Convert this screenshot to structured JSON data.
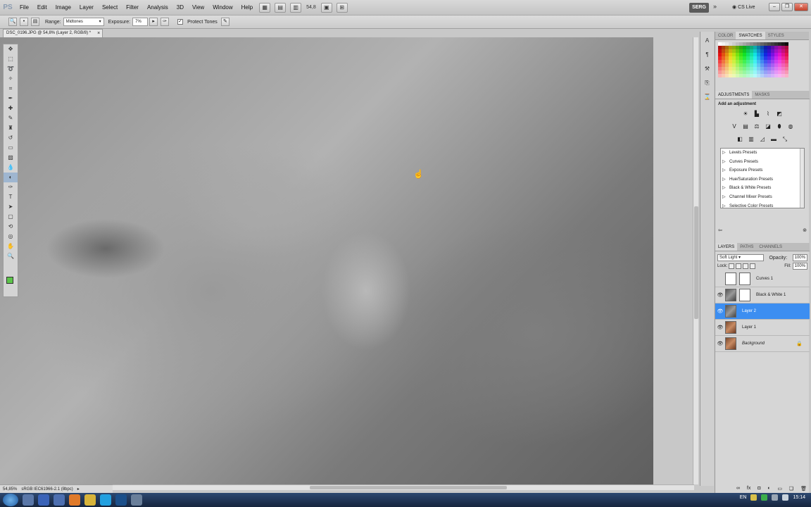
{
  "menubar": {
    "logo": "PS",
    "items": [
      "File",
      "Edit",
      "Image",
      "Layer",
      "Select",
      "Filter",
      "Analysis",
      "3D",
      "View",
      "Window",
      "Help"
    ],
    "zoom": "54,8",
    "workspace": "SERG",
    "cs_live": "CS Live"
  },
  "options": {
    "range_label": "Range:",
    "range_value": "Midtones",
    "exposure_label": "Exposure:",
    "exposure_value": "7%",
    "protect_tones_label": "Protect Tones"
  },
  "document": {
    "tab_title": "DSC_0196.JPG @ 54,8% (Layer 2, RGB/8) *"
  },
  "status": {
    "zoom": "54,85%",
    "profile": "sRGB IEC61966-2.1 (8bpc)"
  },
  "panels": {
    "top_tabs": [
      "COLOR",
      "SWATCHES",
      "STYLES"
    ],
    "adjust_tabs": [
      "ADJUSTMENTS",
      "MASKS"
    ],
    "adjust_title": "Add an adjustment",
    "presets": [
      "Levels Presets",
      "Curves Presets",
      "Exposure Presets",
      "Hue/Saturation Presets",
      "Black & White Presets",
      "Channel Mixer Presets",
      "Selective Color Presets"
    ],
    "layer_tabs": [
      "LAYERS",
      "PATHS",
      "CHANNELS"
    ],
    "blend_mode": "Soft Light",
    "opacity_label": "Opacity:",
    "opacity_value": "100%",
    "lock_label": "Lock:",
    "fill_label": "Fill:",
    "fill_value": "100%",
    "layers": [
      {
        "name": "Curves 1",
        "visible": false,
        "kind": "adjustment"
      },
      {
        "name": "Black & White 1",
        "visible": true,
        "kind": "adjustment"
      },
      {
        "name": "Layer 2",
        "visible": true,
        "kind": "photo",
        "selected": true
      },
      {
        "name": "Layer 1",
        "visible": true,
        "kind": "photo"
      },
      {
        "name": "Background",
        "visible": true,
        "kind": "photo",
        "locked": true
      }
    ]
  },
  "taskbar": {
    "language": "EN",
    "time": "15:14"
  },
  "colors": {
    "accent_selected": "#3c8ef1",
    "foreground_color": "#5cc44a"
  }
}
